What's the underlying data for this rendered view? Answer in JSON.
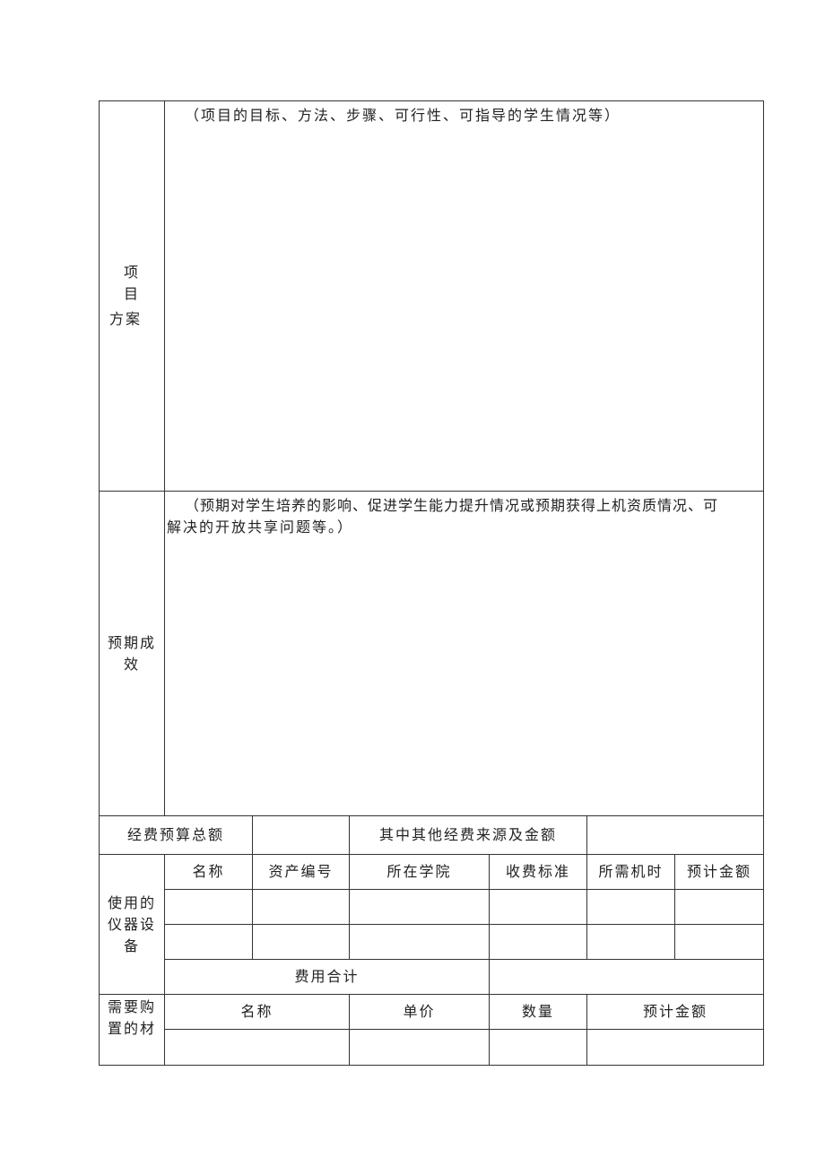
{
  "project_plan": {
    "label_line1_a": "项",
    "label_line1_b": "目",
    "label_line2": "方案",
    "hint": "（项目的目标、方法、步骤、可行性、可指导的学生情况等）"
  },
  "expected_outcome": {
    "label_line1": "预期成",
    "label_line2": "效",
    "hint_line1": "（预期对学生培养的影响、促进学生能力提升情况或预期获得上机资质情况、可",
    "hint_line2": "解决的开放共享问题等。）"
  },
  "budget": {
    "total_label": "经费预算总额",
    "total_value": "",
    "other_sources_label": "其中其他经费来源及金额",
    "other_sources_value": ""
  },
  "instruments": {
    "label_line1": "使用的",
    "label_line2": "仪器设",
    "label_line3": "备",
    "headers": [
      "名称",
      "资产编号",
      "所在学院",
      "收费标准",
      "所需机时",
      "预计金额"
    ],
    "rows": [
      [
        "",
        "",
        "",
        "",
        "",
        ""
      ],
      [
        "",
        "",
        "",
        "",
        "",
        ""
      ]
    ],
    "subtotal_label": "费用合计",
    "subtotal_value": ""
  },
  "materials": {
    "label_line1": "需要购",
    "label_line2": "置的材",
    "headers": [
      "名称",
      "单价",
      "数量",
      "预计金额"
    ],
    "rows": [
      [
        "",
        "",
        "",
        ""
      ]
    ]
  }
}
